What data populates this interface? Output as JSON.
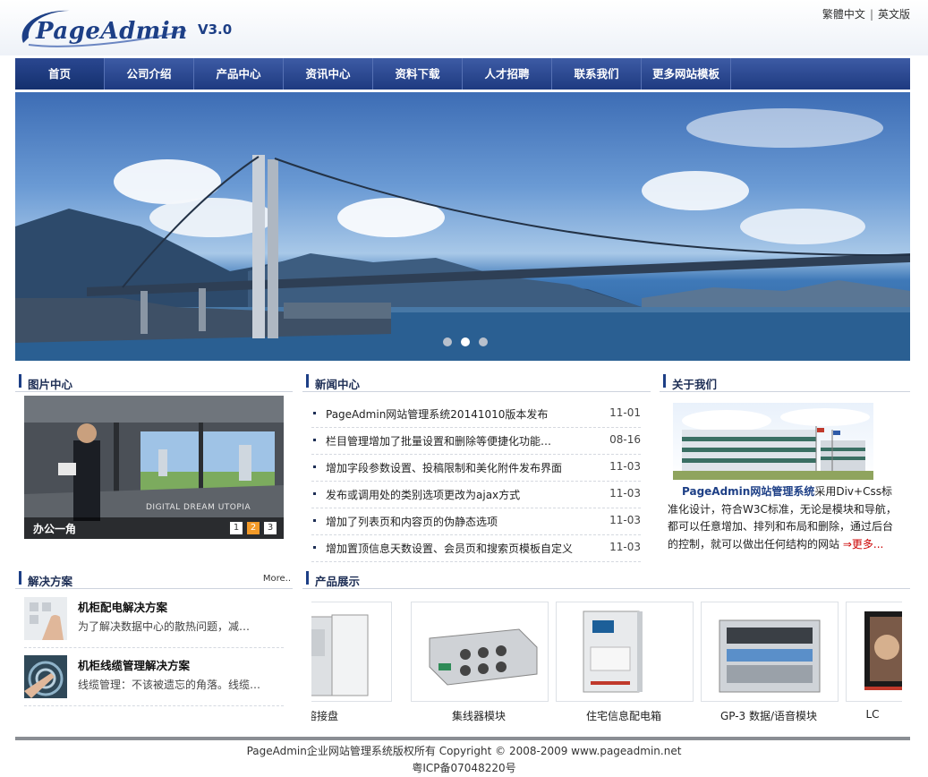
{
  "header": {
    "logo_text": "PageAdmin",
    "logo_version": "V3.0",
    "lang_traditional": "繁體中文",
    "lang_separator": "|",
    "lang_english": "英文版"
  },
  "nav": {
    "items": [
      {
        "label": "首页"
      },
      {
        "label": "公司介绍"
      },
      {
        "label": "产品中心"
      },
      {
        "label": "资讯中心"
      },
      {
        "label": "资料下载"
      },
      {
        "label": "人才招聘"
      },
      {
        "label": "联系我们"
      },
      {
        "label": "更多网站模板"
      }
    ],
    "active_index": 0
  },
  "banner": {
    "slide_count": 3,
    "active_slide": 2
  },
  "pictures": {
    "title": "图片中心",
    "caption": "办公一角",
    "overlay_text": "DIGITAL DREAM UTOPIA",
    "pages": [
      "1",
      "2",
      "3"
    ],
    "active_page": 2
  },
  "news": {
    "title": "新闻中心",
    "items": [
      {
        "title": "PageAdmin网站管理系统20141010版本发布",
        "date": "11-01"
      },
      {
        "title": "栏目管理增加了批量设置和删除等便捷化功能…",
        "date": "08-16"
      },
      {
        "title": "增加字段参数设置、投稿限制和美化附件发布界面",
        "date": "11-03"
      },
      {
        "title": "发布或调用处的类别选项更改为ajax方式",
        "date": "11-03"
      },
      {
        "title": "增加了列表页和内容页的伪静态选项",
        "date": "11-03"
      },
      {
        "title": "增加置顶信息天数设置、会员页和搜索页模板自定义",
        "date": "11-03"
      }
    ]
  },
  "about": {
    "title": "关于我们",
    "lead": "PageAdmin网站管理系统",
    "text": "采用Div+Css标准化设计，符合W3C标准，无论是模块和导航，都可以任意增加、排列和布局和删除，通过后台的控制，就可以做出任何结构的网站",
    "more_arrow": "⇒",
    "more": "更多..."
  },
  "solutions": {
    "title": "解决方案",
    "more": "More..",
    "items": [
      {
        "title": "机柜配电解决方案",
        "desc": "为了解决数据中心的散热问题，减…"
      },
      {
        "title": "机柜线缆管理解决方案",
        "desc": "线缆管理：不该被遗忘的角落。线缆…"
      }
    ]
  },
  "products": {
    "title": "产品展示",
    "items": [
      {
        "label": "熔接盘"
      },
      {
        "label": "集线器模块"
      },
      {
        "label": "住宅信息配电箱"
      },
      {
        "label": "GP-3 数据/语音模块"
      },
      {
        "label": "LC"
      }
    ]
  },
  "footer": {
    "line1": "PageAdmin企业网站管理系统版权所有 Copyright © 2008-2009   www.pageadmin.net",
    "line2": "粤ICP备07048220号"
  },
  "colors": {
    "nav_bg": "#2a4790",
    "brand": "#1d3f86",
    "pager_active": "#f39a28",
    "more_link": "#cc0000"
  }
}
